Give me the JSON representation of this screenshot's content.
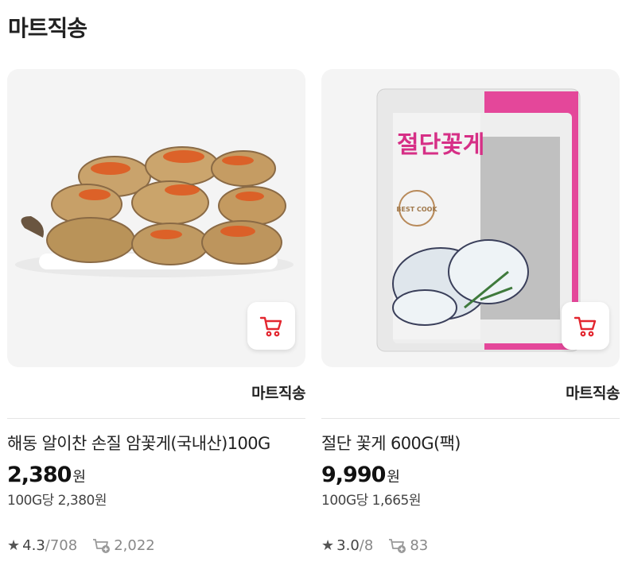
{
  "section": {
    "title": "마트직송"
  },
  "products": [
    {
      "name": "해동 알이찬 손질 암꽃게(국내산)100G",
      "price": "2,380",
      "currency": "원",
      "unit_price": "100G당 2,380원",
      "shipper": "마트직송",
      "rating": "4.3",
      "reviews": "/708",
      "cart_count": "2,022"
    },
    {
      "name": "절단 꽃게 600G(팩)",
      "price": "9,990",
      "currency": "원",
      "unit_price": "100G당 1,665원",
      "shipper": "마트직송",
      "rating": "3.0",
      "reviews": "/8",
      "cart_count": "83",
      "package_label": "절단꽃게",
      "package_badge": "BEST COOK"
    }
  ],
  "colors": {
    "accent": "#e3262f",
    "pink": "#e4479a"
  }
}
